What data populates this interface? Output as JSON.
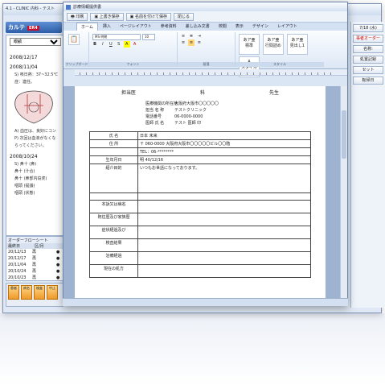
{
  "back": {
    "title": "4.1 - CLINIC 内科 - テスト",
    "karte_tab": "カルテ",
    "karte_badge": "ER4",
    "dept_select": "眼顧",
    "notes": [
      {
        "date": "2008/12/17",
        "lines": []
      },
      {
        "date": "2008/11/04",
        "lines": [
          "S) 咳日熱：37~32.5℃",
          "症：連任。"
        ]
      },
      {
        "date": "",
        "lines": [
          "A) 血圧は、良好にコン",
          "P) 次回は血液がなくな",
          "らってください。"
        ]
      },
      {
        "date": "2008/10/24",
        "lines": [
          "S) 鼻十 (鼻)",
          "鼻十 (汁合)",
          "鼻十 (鼻部内窃虎)",
          "咽頭 (提議)",
          "咽頭 (状態)"
        ]
      }
    ],
    "order": {
      "title": "オーダーフローシート",
      "cols": [
        "最終日",
        "区/月"
      ],
      "rows": [
        {
          "date": "20/12/13",
          "kind": "再"
        },
        {
          "date": "20/12/17",
          "kind": "再"
        },
        {
          "date": "20/11/04",
          "kind": "再"
        },
        {
          "date": "20/10/24",
          "kind": "再"
        },
        {
          "date": "20/10/23",
          "kind": "再"
        }
      ]
    },
    "bottom_icons": [
      "患者",
      "病名",
      "検査",
      "中止"
    ],
    "right_buttons": [
      "7/18 (水)",
      "事者オーダー",
      "名称:",
      "処置記録",
      "セット",
      "転帰日"
    ]
  },
  "front": {
    "title": "診療情報提供書",
    "toolbar": [
      "印刷",
      "上書き保存",
      "名前を付けて保存",
      "閉じる"
    ],
    "tabs": [
      "ホーム",
      "挿入",
      "ページレイアウト",
      "参考資料",
      "差し込み文書",
      "校閲",
      "表示",
      "デザイン",
      "レイアウト"
    ],
    "font_name": "MS 明朝",
    "font_size": "10",
    "styles": [
      "あア亜",
      "あア亜",
      "あア亜"
    ],
    "style_labels": [
      "標準",
      "行間詰め",
      "見出し1"
    ],
    "style_change": "スタイルの変更",
    "group_labels": [
      "クリップボード",
      "フォント",
      "段落",
      "スタイル"
    ],
    "doc": {
      "header_left": "担当医",
      "header_mid": "科",
      "header_right": "先生",
      "info": [
        {
          "k": "医療機関の所在地",
          "v": "大阪府大阪市〇〇〇〇〇"
        },
        {
          "k": "担当 名 称",
          "v": "テストクリニック"
        },
        {
          "k": "電話番号",
          "v": "06-0000-0000"
        },
        {
          "k": "医師 氏 名",
          "v": "テスト 医師   印"
        }
      ],
      "rows": [
        {
          "label": "氏 名",
          "value": "日本 未来"
        },
        {
          "label": "住 所",
          "value": "〒 060-0000 大阪府大阪市〇〇〇〇〇ビル〇〇階"
        },
        {
          "label": "",
          "value": "TEL：06-********"
        },
        {
          "label": "生年月日",
          "value": "明 40/12/16"
        },
        {
          "label": "紹介目的",
          "value": "いつもお世話になっております。"
        },
        {
          "label": "",
          "value": ""
        },
        {
          "label": "本訴又は病名",
          "value": ""
        },
        {
          "label": "既往歴及び家族歴",
          "value": ""
        },
        {
          "label": "症状経過及び",
          "value": ""
        },
        {
          "label": "検査結果",
          "value": ""
        },
        {
          "label": "治療経過",
          "value": ""
        },
        {
          "label": "現在の処方",
          "value": ""
        }
      ]
    }
  }
}
